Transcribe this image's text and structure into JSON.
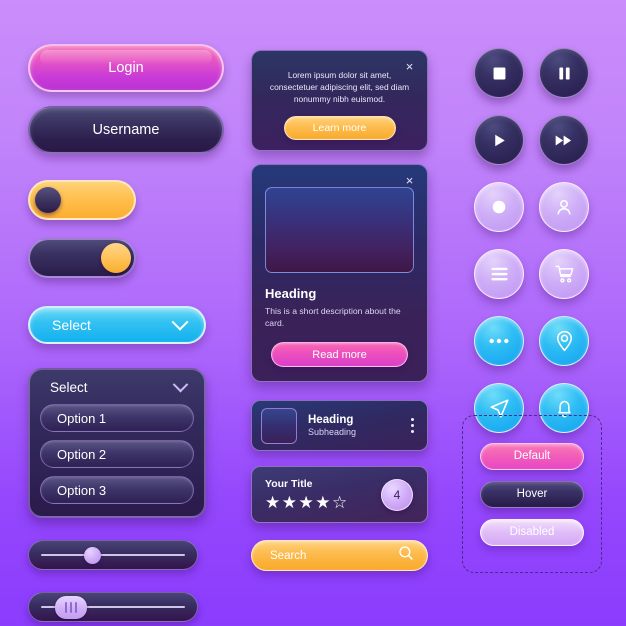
{
  "theme": {
    "bg_top": "#cb8dfa",
    "bg_bottom": "#8b3cfd",
    "accent_pink": "#ef52bc",
    "accent_orange": "#fcba4b",
    "accent_cyan": "#35c2f2",
    "accent_lilac": "#cfaef7",
    "dark_navy": "#2c2a66"
  },
  "controls": {
    "login_label": "Login",
    "username_label": "Username",
    "toggle_on_label": "toggle-on",
    "toggle_off_label": "toggle-off",
    "select_label": "Select"
  },
  "dropdown": {
    "header_label": "Select",
    "options": [
      {
        "label": "Option 1"
      },
      {
        "label": "Option 2"
      },
      {
        "label": "Option 3"
      }
    ]
  },
  "sliders": [
    {
      "name": "slider-round-thumb",
      "value": 30
    },
    {
      "name": "slider-bar-thumb",
      "value": 12
    }
  ],
  "promo_card": {
    "close_label": "×",
    "body": "Lorem ipsum dolor sit amet, consectetuer adipiscing elit, sed diam nonummy nibh euismod.",
    "cta_label": "Learn more"
  },
  "media_card": {
    "close_label": "×",
    "heading": "Heading",
    "description": "This is a short description about the card.",
    "cta_label": "Read more"
  },
  "list_item": {
    "heading": "Heading",
    "subheading": "Subheading",
    "menu_label": "more-options"
  },
  "rating_card": {
    "title": "Your Title",
    "stars_filled": 4,
    "stars_total": 5,
    "filled_glyph": "★",
    "empty_glyph": "☆",
    "badge_value": "4"
  },
  "search": {
    "placeholder": "Search",
    "value": "Search"
  },
  "icon_buttons": [
    {
      "name": "stop-icon",
      "style": "dark",
      "label": "Stop"
    },
    {
      "name": "pause-icon",
      "style": "dark",
      "label": "Pause"
    },
    {
      "name": "play-icon",
      "style": "dark",
      "label": "Play"
    },
    {
      "name": "fast-forward-icon",
      "style": "dark",
      "label": "Fast forward"
    },
    {
      "name": "record-icon",
      "style": "lilac",
      "label": "Record"
    },
    {
      "name": "user-icon",
      "style": "lilac",
      "label": "User"
    },
    {
      "name": "menu-icon",
      "style": "lilac",
      "label": "Menu"
    },
    {
      "name": "cart-icon",
      "style": "lilac",
      "label": "Cart"
    },
    {
      "name": "more-icon",
      "style": "blue",
      "label": "More"
    },
    {
      "name": "location-pin-icon",
      "style": "blue",
      "label": "Location"
    },
    {
      "name": "send-icon",
      "style": "blue",
      "label": "Send"
    },
    {
      "name": "bell-icon",
      "style": "blue",
      "label": "Notifications"
    }
  ],
  "states": {
    "default_label": "Default",
    "hover_label": "Hover",
    "disabled_label": "Disabled"
  }
}
